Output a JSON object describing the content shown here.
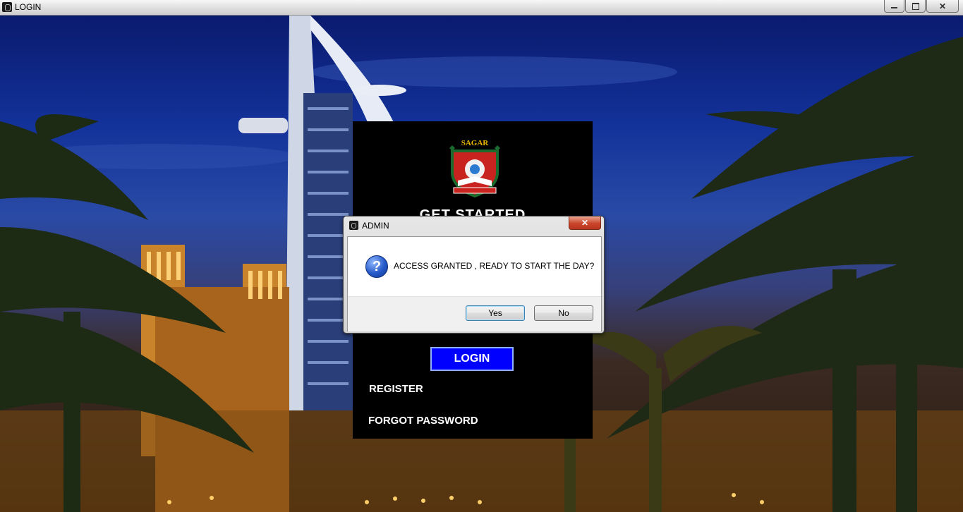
{
  "window": {
    "title": "LOGIN"
  },
  "panel": {
    "logo_text": "SAGAR",
    "title": "GET STARTED",
    "login_label": "LOGIN",
    "register_label": "REGISTER",
    "forgot_label": "FORGOT PASSWORD"
  },
  "dialog": {
    "title": "ADMIN",
    "message": "ACCESS GRANTED , READY TO START THE DAY?",
    "icon": "question-icon",
    "yes_label": "Yes",
    "no_label": "No"
  },
  "colors": {
    "login_button": "#0000ff",
    "panel_background": "#000000"
  }
}
